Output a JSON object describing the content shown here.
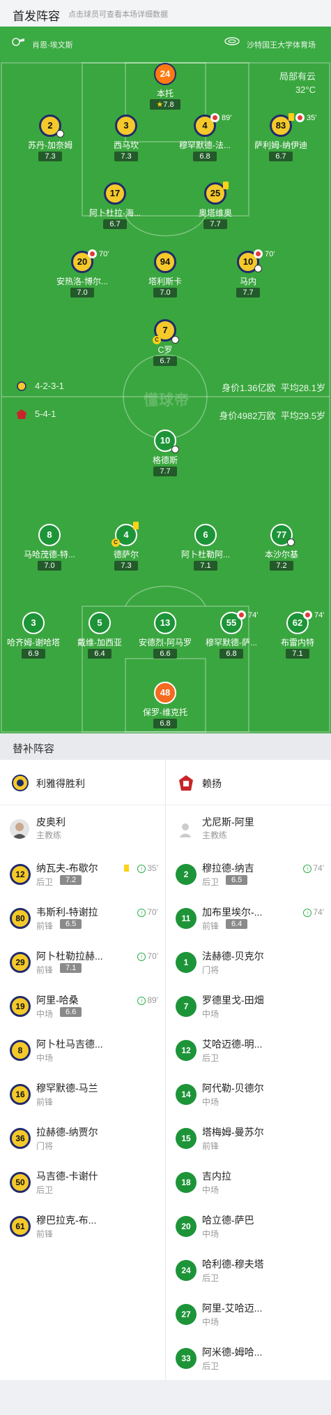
{
  "header": {
    "title": "首发阵容",
    "subtitle": "点击球员可查看本场详细数据"
  },
  "pitch_bar": {
    "referee": "肖恩-埃文斯",
    "stadium": "沙特国王大学体育场",
    "weather": "局部有云",
    "temperature": "32°C"
  },
  "watermark": "懂球帝",
  "home_team": {
    "formation": "4-2-3-1",
    "value": "身价1.36亿欧",
    "age": "平均28.1岁",
    "players": [
      {
        "num": "24",
        "name": "本托",
        "rating": "7.8",
        "star": true
      },
      {
        "num": "2",
        "name": "苏丹-加奈姆",
        "rating": "7.3"
      },
      {
        "num": "3",
        "name": "西马坎",
        "rating": "7.3"
      },
      {
        "num": "4",
        "name": "穆罕默德-法...",
        "rating": "6.8",
        "sub_min": "89'"
      },
      {
        "num": "83",
        "name": "萨利姆-纳伊迪",
        "rating": "6.7",
        "sub_min": "35'"
      },
      {
        "num": "17",
        "name": "阿卜杜拉-海...",
        "rating": "6.7"
      },
      {
        "num": "25",
        "name": "奥塔维奥",
        "rating": "7.7"
      },
      {
        "num": "20",
        "name": "安热洛-博尔...",
        "rating": "7.0",
        "sub_min": "70'"
      },
      {
        "num": "94",
        "name": "塔利斯卡",
        "rating": "7.0"
      },
      {
        "num": "10",
        "name": "马内",
        "rating": "7.7",
        "sub_min": "70'"
      },
      {
        "num": "7",
        "name": "C罗",
        "rating": "6.7",
        "cap": "C"
      }
    ]
  },
  "away_team": {
    "formation": "5-4-1",
    "value": "身价4982万欧",
    "age": "平均29.5岁",
    "players": [
      {
        "num": "10",
        "name": "格德斯",
        "rating": "7.7"
      },
      {
        "num": "8",
        "name": "马哈茂德-特...",
        "rating": "7.0"
      },
      {
        "num": "4",
        "name": "德萨尔",
        "rating": "7.3",
        "cap": "C"
      },
      {
        "num": "6",
        "name": "阿卜杜勒阿...",
        "rating": "7.1"
      },
      {
        "num": "77",
        "name": "本沙尔基",
        "rating": "7.2"
      },
      {
        "num": "3",
        "name": "哈齐姆-谢哈塔",
        "rating": "6.9"
      },
      {
        "num": "5",
        "name": "戴维-加西亚",
        "rating": "6.4"
      },
      {
        "num": "13",
        "name": "安德烈-阿马罗",
        "rating": "6.6"
      },
      {
        "num": "55",
        "name": "穆罕默德-萨...",
        "rating": "6.8",
        "sub_min": "74'"
      },
      {
        "num": "62",
        "name": "布雷内特",
        "rating": "7.1",
        "sub_min": "74'"
      },
      {
        "num": "48",
        "name": "保罗-维克托",
        "rating": "6.8"
      }
    ]
  },
  "bench_title": "替补阵容",
  "bench": {
    "home": {
      "team": "利雅得胜利",
      "manager": {
        "name": "皮奥利",
        "role": "主教练"
      },
      "subs": [
        {
          "num": "12",
          "name": "纳瓦夫-布歇尔",
          "pos": "后卫",
          "rating": "7.2",
          "sub": "35'",
          "yellow": true
        },
        {
          "num": "80",
          "name": "韦斯利-特谢拉",
          "pos": "前锋",
          "rating": "6.5",
          "sub": "70'"
        },
        {
          "num": "29",
          "name": "阿卜杜勒拉赫...",
          "pos": "前锋",
          "rating": "7.1",
          "sub": "70'"
        },
        {
          "num": "19",
          "name": "阿里-哈桑",
          "pos": "中场",
          "rating": "6.6",
          "sub": "89'"
        },
        {
          "num": "8",
          "name": "阿卜杜马吉德...",
          "pos": "中场"
        },
        {
          "num": "16",
          "name": "穆罕默德-马兰",
          "pos": "前锋"
        },
        {
          "num": "36",
          "name": "拉赫德-纳贾尔",
          "pos": "门将"
        },
        {
          "num": "50",
          "name": "马吉德-卡谢什",
          "pos": "后卫"
        },
        {
          "num": "61",
          "name": "穆巴拉克-布...",
          "pos": "前锋"
        }
      ]
    },
    "away": {
      "team": "赖扬",
      "manager": {
        "name": "尤尼斯-阿里",
        "role": "主教练"
      },
      "subs": [
        {
          "num": "2",
          "name": "穆拉德-纳吉",
          "pos": "后卫",
          "rating": "6.5",
          "sub": "74'"
        },
        {
          "num": "11",
          "name": "加布里埃尔-...",
          "pos": "前锋",
          "rating": "6.4",
          "sub": "74'"
        },
        {
          "num": "1",
          "name": "法赫德-贝克尔",
          "pos": "门将"
        },
        {
          "num": "7",
          "name": "罗德里戈-田畑",
          "pos": "中场"
        },
        {
          "num": "12",
          "name": "艾哈迈德-明...",
          "pos": "后卫"
        },
        {
          "num": "14",
          "name": "阿代勒-贝德尔",
          "pos": "中场"
        },
        {
          "num": "15",
          "name": "塔梅姆-曼苏尔",
          "pos": "前锋"
        },
        {
          "num": "18",
          "name": "吉内拉",
          "pos": "中场"
        },
        {
          "num": "20",
          "name": "哈立德-萨巴",
          "pos": "中场"
        },
        {
          "num": "24",
          "name": "哈利德-穆夫塔",
          "pos": "后卫"
        },
        {
          "num": "27",
          "name": "阿里-艾哈迈...",
          "pos": "中场"
        },
        {
          "num": "33",
          "name": "阿米德-姆哈...",
          "pos": "后卫"
        }
      ]
    }
  }
}
